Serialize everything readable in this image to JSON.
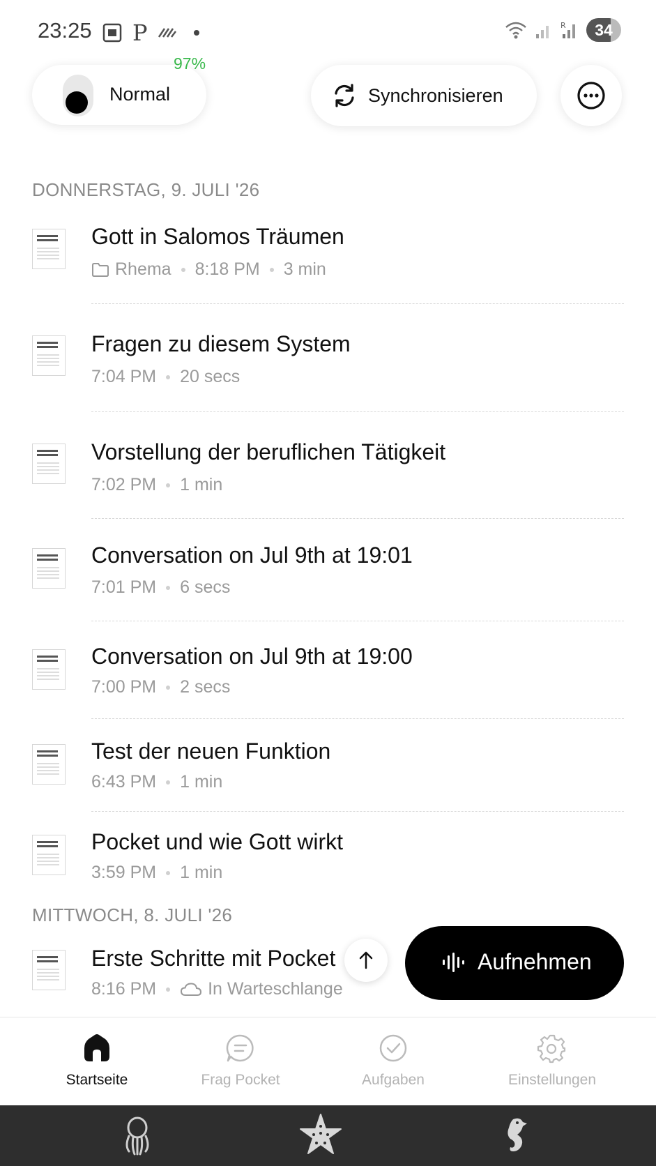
{
  "status_bar": {
    "time": "23:25",
    "battery_level": "34",
    "icons": [
      "screenshot-icon",
      "parking-icon",
      "signal-strikes-icon",
      "dot-icon",
      "wifi-icon",
      "cell-signal-icon",
      "cell-signal-roaming-icon"
    ]
  },
  "header": {
    "mode_label": "Normal",
    "battery_percent": "97%",
    "sync_label": "Synchronisieren"
  },
  "sections": [
    {
      "header": "DONNERSTAG, 9. JULI '26",
      "items": [
        {
          "title": "Gott in Salomos Träumen",
          "folder": "Rhema",
          "time": "8:18 PM",
          "duration": "3 min"
        },
        {
          "title": "Fragen zu diesem System",
          "time": "7:04 PM",
          "duration": "20 secs"
        },
        {
          "title": "Vorstellung der beruflichen Tätigkeit",
          "time": "7:02 PM",
          "duration": "1 min"
        },
        {
          "title": "Conversation on Jul 9th at 19:01",
          "time": "7:01 PM",
          "duration": "6 secs"
        },
        {
          "title": "Conversation on Jul 9th at 19:00",
          "time": "7:00 PM",
          "duration": "2 secs"
        },
        {
          "title": "Test der neuen Funktion",
          "time": "6:43 PM",
          "duration": "1 min"
        },
        {
          "title": "Pocket und wie Gott wirkt",
          "time": "3:59 PM",
          "duration": "1 min"
        }
      ]
    },
    {
      "header": "MITTWOCH, 8. JULI '26",
      "items": [
        {
          "title": "Erste Schritte mit Pocket",
          "time": "8:16 PM",
          "status": "In Warteschlange"
        }
      ]
    }
  ],
  "record_button": {
    "label": "Aufnehmen"
  },
  "tabs": [
    {
      "label": "Startseite",
      "icon": "home-icon",
      "active": true
    },
    {
      "label": "Frag Pocket",
      "icon": "chat-icon",
      "active": false
    },
    {
      "label": "Aufgaben",
      "icon": "check-circle-icon",
      "active": false
    },
    {
      "label": "Einstellungen",
      "icon": "gear-icon",
      "active": false
    }
  ],
  "system_nav": [
    "octopus-icon",
    "starfish-icon",
    "seahorse-icon"
  ],
  "colors": {
    "accent": "#000000",
    "battery_green": "#38b84a",
    "muted_text": "#9a9a9a"
  }
}
